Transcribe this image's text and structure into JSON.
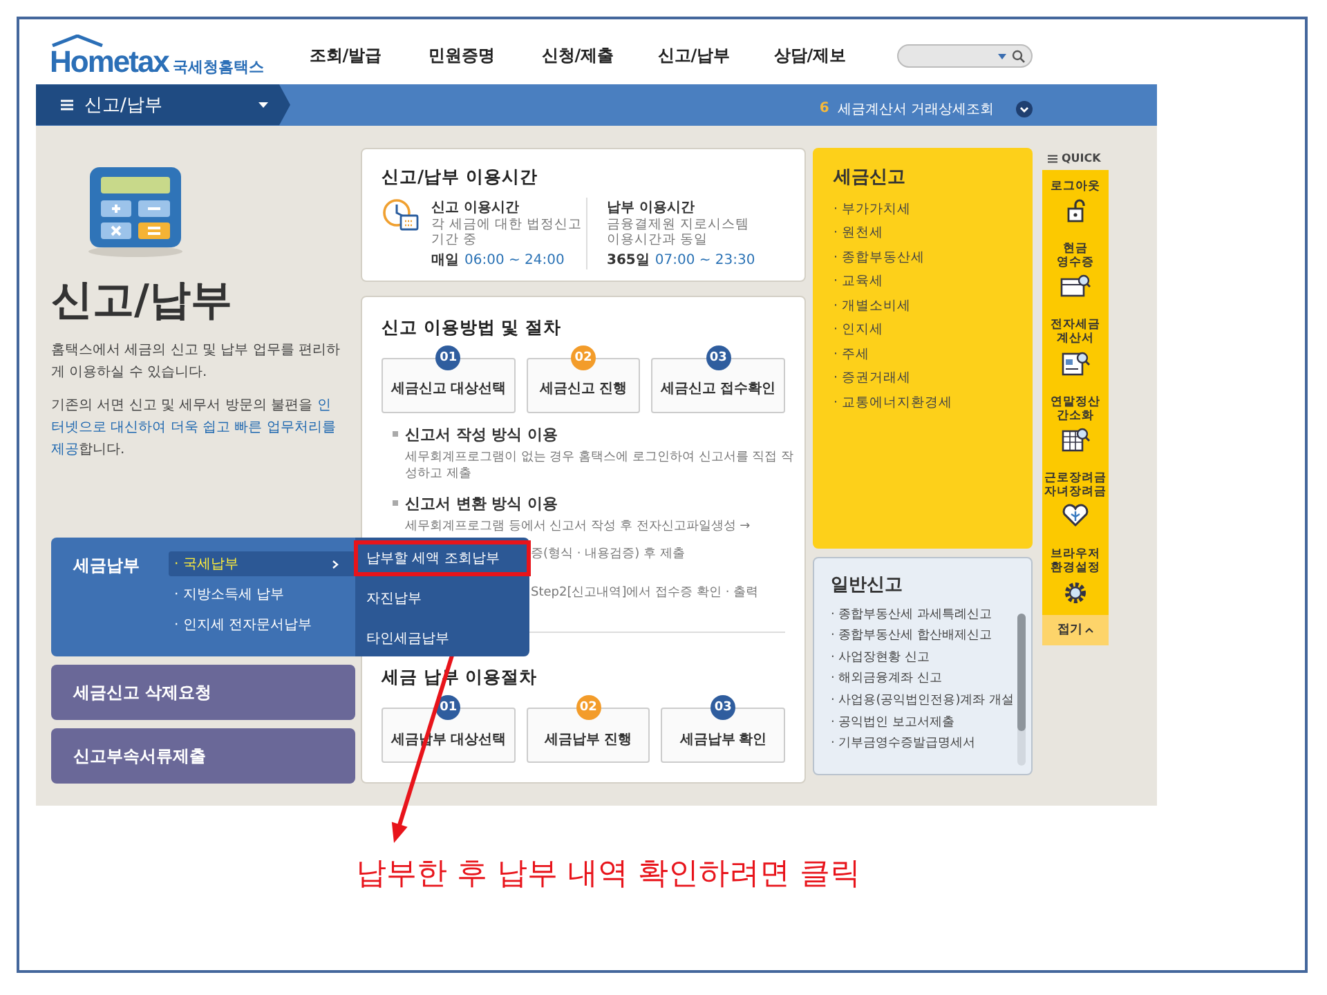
{
  "header": {
    "logo": {
      "name": "Hometax",
      "korean": "국세청홈택스"
    },
    "nav": [
      {
        "label": "조회/발급"
      },
      {
        "label": "민원증명"
      },
      {
        "label": "신청/제출"
      },
      {
        "label": "신고/납부"
      },
      {
        "label": "상담/제보"
      }
    ]
  },
  "menu_bar": {
    "label": "신고/납부",
    "ticker": {
      "number": "6",
      "text": "세금계산서 거래상세조회"
    }
  },
  "intro": {
    "title": "신고/납부",
    "paragraphs": [
      "홈택스에서 세금의 신고 및 납부 업무를 편리하게 이용하실 수 있습니다.",
      "기존의 서면 신고 및 세무서 방문의 불편을 **인터넷으로 대신하여 더욱 쉽고 빠른 업무처리를 제공**합니다."
    ]
  },
  "payment_menu": {
    "title": "세금납부",
    "items": [
      {
        "label": "· 국세납부",
        "selected": true,
        "submenu": [
          {
            "label": "납부할 세액 조회납부",
            "annotated": true
          },
          {
            "label": "자진납부",
            "annotated": false
          },
          {
            "label": "타인세금납부",
            "annotated": false
          }
        ]
      },
      {
        "label": "· 지방소득세 납부",
        "selected": false
      },
      {
        "label": "· 인지세 전자문서납부",
        "selected": false
      }
    ]
  },
  "side_buttons": [
    "세금신고 삭제요청",
    "신고부속서류제출"
  ],
  "hours": {
    "title": "신고/납부 이용시간",
    "blocks": [
      {
        "title": "신고 이용시간",
        "desc": "각 세금에 대한 법정신고 기간 중",
        "day": "매일",
        "time": "06:00 ~ 24:00",
        "icon": true
      },
      {
        "title": "납부 이용시간",
        "desc": "금융결제원 지로시스템 이용시간과 동일",
        "day": "365일",
        "time": "07:00 ~ 23:30"
      }
    ]
  },
  "procedure": {
    "title": "신고 이용방법 및 절차",
    "steps": [
      {
        "number": "01",
        "label": "세금신고 대상선택",
        "color": "#2f5d9e"
      },
      {
        "number": "02",
        "label": "세금신고 진행",
        "color": "#f39c2a"
      },
      {
        "number": "03",
        "label": "세금신고 접수확인",
        "color": "#2f5d9e"
      }
    ],
    "methods": [
      {
        "title": "신고서 작성 방식 이용",
        "lines": [
          "세무회계프로그램이 없는 경우 홈택스에 로그인하여 신고서를 직접 작성하고 제출"
        ]
      },
      {
        "title": "신고서 변환 방식 이용",
        "lines": [
          "세무회계프로그램 등에서 신고서 작성 후 전자신고파일생성 →"
        ]
      }
    ],
    "visible_fragments": [
      "증(형식 · 내용검증) 후 제출",
      "Step2[신고내역]에서 접수증 확인 · 출력"
    ]
  },
  "payment": {
    "title": "세금 납부 이용절차",
    "steps": [
      {
        "number": "01",
        "label": "세금납부 대상선택",
        "color": "#2f5d9e"
      },
      {
        "number": "02",
        "label": "세금납부 진행",
        "color": "#f39c2a"
      },
      {
        "number": "03",
        "label": "세금납부 확인",
        "color": "#2f5d9e"
      }
    ]
  },
  "tax_report": {
    "title": "세금신고",
    "items": [
      "· 부가가치세",
      "· 원천세",
      "· 종합부동산세",
      "· 교육세",
      "· 개별소비세",
      "· 인지세",
      "· 주세",
      "· 증권거래세",
      "· 교통에너지환경세"
    ]
  },
  "general_report": {
    "title": "일반신고",
    "items": [
      "· 종합부동산세 과세특례신고",
      "· 종합부동산세 합산배제신고",
      "· 사업장현황 신고",
      "· 해외금융계좌 신고",
      "· 사업용(공익법인전용)계좌 개설",
      "· 공익법인 보고서제출",
      "· 기부금영수증발급명세서"
    ]
  },
  "quick": {
    "title": "QUICK",
    "items": [
      {
        "label": "로그아웃",
        "kind": "logout"
      },
      {
        "label": "현금\n영수증",
        "kind": "receipt"
      },
      {
        "label": "전자세금\n계산서",
        "kind": "invoice"
      },
      {
        "label": "연말정산\n간소화",
        "kind": "yearend"
      },
      {
        "label": "근로장려금\n자녀장려금",
        "kind": "incentive"
      },
      {
        "label": "브라우저\n환경설정",
        "kind": "settings"
      }
    ],
    "footer": "접기"
  },
  "annotation": "납부한 후 납부 내역 확인하려면 클릭"
}
